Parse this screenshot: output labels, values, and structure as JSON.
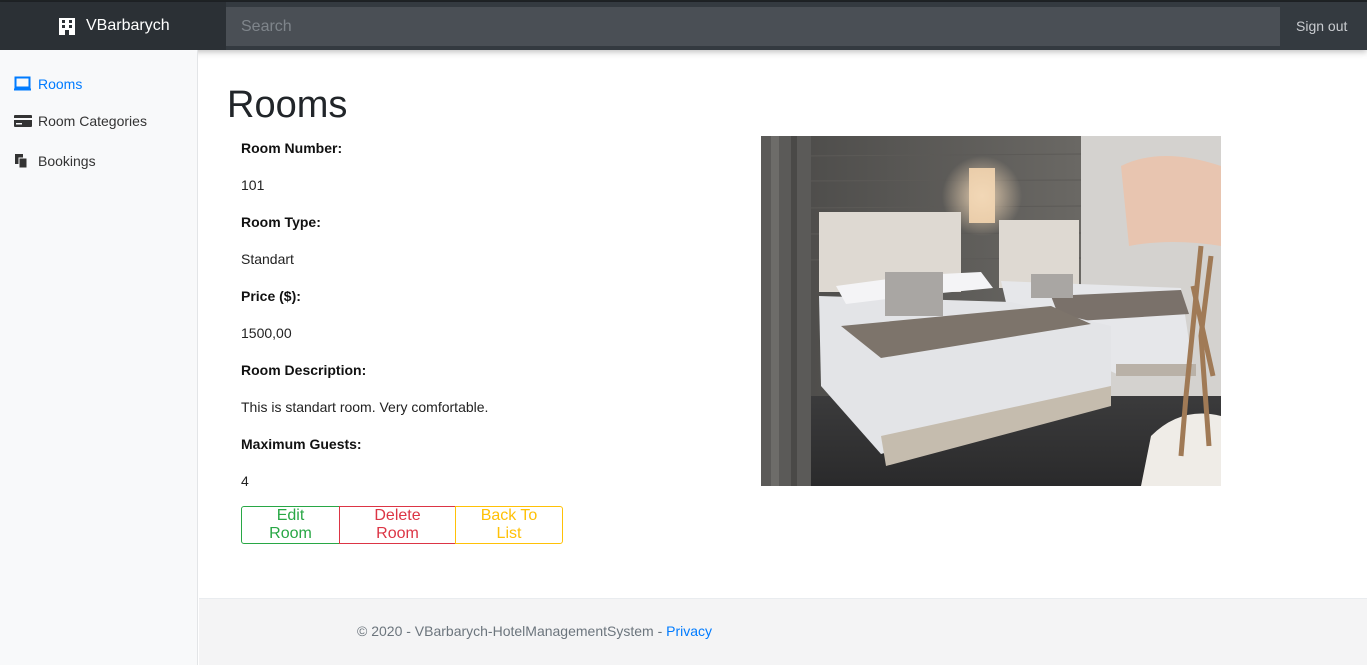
{
  "app": {
    "brand": "VBarbarych"
  },
  "header": {
    "search_placeholder": "Search",
    "signout_label": "Sign out"
  },
  "sidebar": {
    "items": [
      {
        "label": "Rooms",
        "icon": "monitor-icon",
        "active": true
      },
      {
        "label": "Room Categories",
        "icon": "card-icon",
        "active": false
      },
      {
        "label": "Bookings",
        "icon": "documents-icon",
        "active": false
      }
    ]
  },
  "page": {
    "title": "Rooms"
  },
  "room": {
    "fields": [
      {
        "label": "Room Number:",
        "value": "101"
      },
      {
        "label": "Room Type:",
        "value": "Standart"
      },
      {
        "label": "Price ($):",
        "value": "1500,00"
      },
      {
        "label": "Room Description:",
        "value": "This is standart room. Very comfortable."
      },
      {
        "label": "Maximum Guests:",
        "value": "4"
      }
    ]
  },
  "actions": {
    "edit_label": "Edit Room",
    "delete_label": "Delete Room",
    "back_label": "Back To List"
  },
  "footer": {
    "copyright": "© 2020 - VBarbarych-HotelManagementSystem - ",
    "privacy_label": "Privacy"
  },
  "colors": {
    "primary": "#007bff",
    "success": "#28a745",
    "danger": "#dc3545",
    "warning": "#ffc107",
    "navbar": "#343a40"
  }
}
